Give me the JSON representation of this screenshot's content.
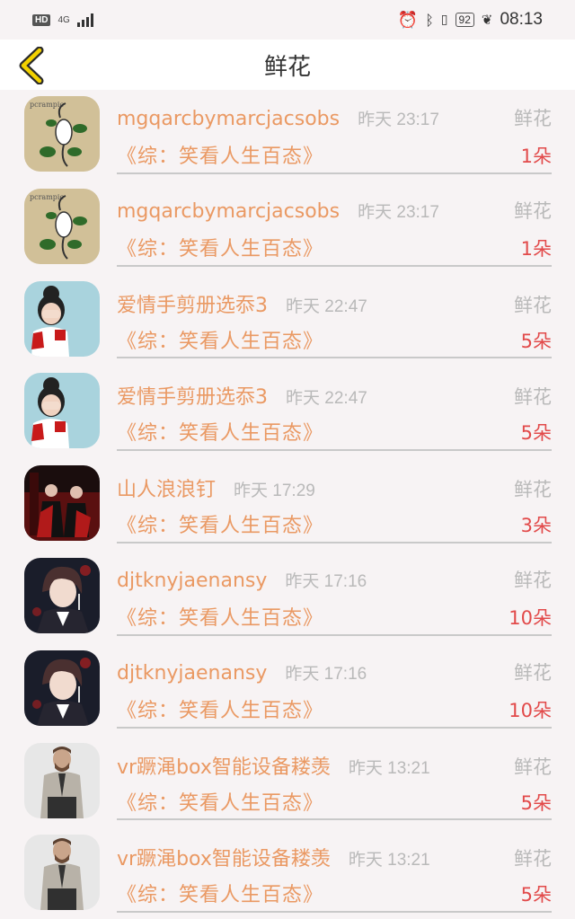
{
  "status_bar": {
    "hd": "HD",
    "network": "4G",
    "battery": "92",
    "time": "08:13",
    "icons": [
      "alarm-icon",
      "bluetooth-icon",
      "vibrate-icon",
      "leaf-icon"
    ]
  },
  "nav": {
    "title": "鲜花",
    "back_icon": "chevron-left-icon"
  },
  "items": [
    {
      "user": "mgqarcbymarcjacsobs",
      "time": "昨天 23:17",
      "gift": "鲜花",
      "book": "《综：笑看人生百态》",
      "count": "1朵",
      "avatar": "sketch-art"
    },
    {
      "user": "mgqarcbymarcjacsobs",
      "time": "昨天 23:17",
      "gift": "鲜花",
      "book": "《综：笑看人生百态》",
      "count": "1朵",
      "avatar": "sketch-art"
    },
    {
      "user": "爱情手剪册选忝3",
      "time": "昨天 22:47",
      "gift": "鲜花",
      "book": "《综：笑看人生百态》",
      "count": "5朵",
      "avatar": "girl-face"
    },
    {
      "user": "爱情手剪册选忝3",
      "time": "昨天 22:47",
      "gift": "鲜花",
      "book": "《综：笑看人生百态》",
      "count": "5朵",
      "avatar": "girl-face"
    },
    {
      "user": "山人浪浪钉",
      "time": "昨天 17:29",
      "gift": "鲜花",
      "book": "《综：笑看人生百态》",
      "count": "3朵",
      "avatar": "red-room"
    },
    {
      "user": "djtknyjaenansy",
      "time": "昨天 17:16",
      "gift": "鲜花",
      "book": "《综：笑看人生百态》",
      "count": "10朵",
      "avatar": "anime-man"
    },
    {
      "user": "djtknyjaenansy",
      "time": "昨天 17:16",
      "gift": "鲜花",
      "book": "《综：笑看人生百态》",
      "count": "10朵",
      "avatar": "anime-man"
    },
    {
      "user": "vr蹶渑box智能设备耧羡",
      "time": "昨天 13:21",
      "gift": "鲜花",
      "book": "《综：笑看人生百态》",
      "count": "5朵",
      "avatar": "bearded-man"
    },
    {
      "user": "vr蹶渑box智能设备耧羡",
      "time": "昨天 13:21",
      "gift": "鲜花",
      "book": "《综：笑看人生百态》",
      "count": "5朵",
      "avatar": "bearded-man"
    }
  ]
}
